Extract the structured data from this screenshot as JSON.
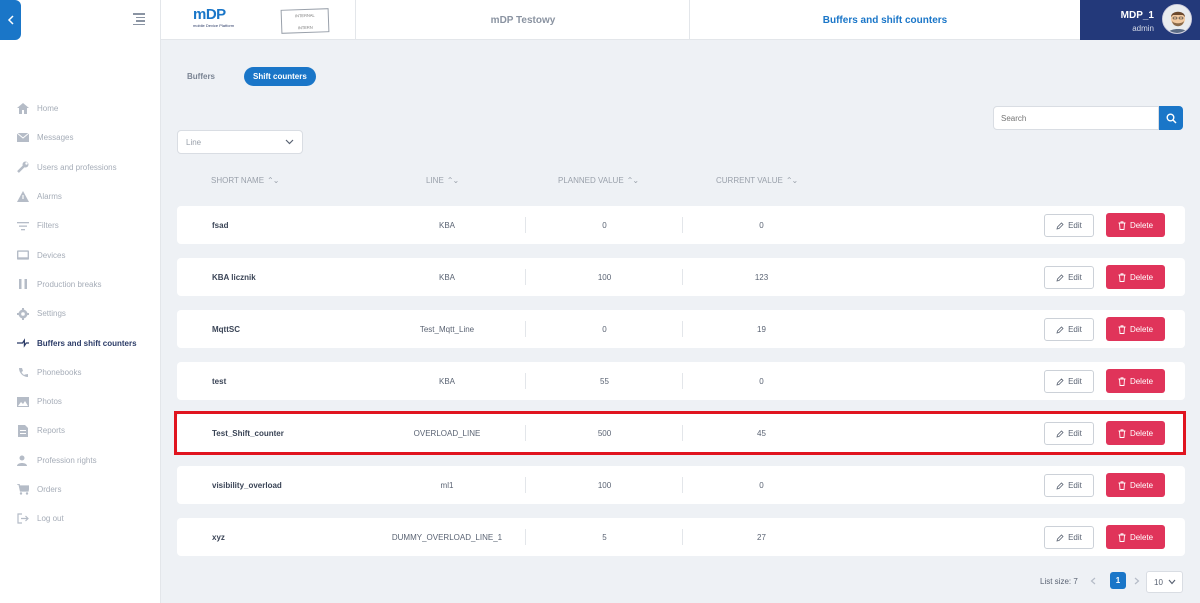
{
  "header": {
    "logo_main": "mDP",
    "logo_sub": "mobile Device Platform",
    "stamp_line1": "INTERNAL",
    "stamp_line2": "INTERN",
    "app_title": "mDP Testowy",
    "page_title": "Buffers and shift counters",
    "user_name": "MDP_1",
    "user_role": "admin"
  },
  "sidebar": {
    "items": [
      {
        "label": "Home",
        "icon": "home-icon"
      },
      {
        "label": "Messages",
        "icon": "mail-icon"
      },
      {
        "label": "Users and professions",
        "icon": "wrench-icon"
      },
      {
        "label": "Alarms",
        "icon": "warning-icon"
      },
      {
        "label": "Filters",
        "icon": "filter-icon"
      },
      {
        "label": "Devices",
        "icon": "devices-icon"
      },
      {
        "label": "Production breaks",
        "icon": "pause-icon"
      },
      {
        "label": "Settings",
        "icon": "gear-icon"
      },
      {
        "label": "Buffers and shift counters",
        "icon": "buffers-icon",
        "active": true
      },
      {
        "label": "Phonebooks",
        "icon": "phone-icon"
      },
      {
        "label": "Photos",
        "icon": "photo-icon"
      },
      {
        "label": "Reports",
        "icon": "report-icon"
      },
      {
        "label": "Profession rights",
        "icon": "user-key-icon"
      },
      {
        "label": "Orders",
        "icon": "cart-icon"
      },
      {
        "label": "Log out",
        "icon": "logout-icon"
      }
    ]
  },
  "tabs": [
    {
      "label": "Buffers",
      "active": false
    },
    {
      "label": "Shift counters",
      "active": true
    }
  ],
  "filter": {
    "placeholder": "Line"
  },
  "search": {
    "placeholder": "Search"
  },
  "columns": {
    "short_name": "SHORT NAME",
    "line": "LINE",
    "planned": "PLANNED VALUE",
    "current": "CURRENT VALUE"
  },
  "rows": [
    {
      "name": "fsad",
      "line": "KBA",
      "planned": "0",
      "current": "0"
    },
    {
      "name": "KBA licznik",
      "line": "KBA",
      "planned": "100",
      "current": "123"
    },
    {
      "name": "MqttSC",
      "line": "Test_Mqtt_Line",
      "planned": "0",
      "current": "19"
    },
    {
      "name": "test",
      "line": "KBA",
      "planned": "55",
      "current": "0"
    },
    {
      "name": "Test_Shift_counter",
      "line": "OVERLOAD_LINE",
      "planned": "500",
      "current": "45"
    },
    {
      "name": "visibility_overload",
      "line": "ml1",
      "planned": "100",
      "current": "0"
    },
    {
      "name": "xyz",
      "line": "DUMMY_OVERLOAD_LINE_1",
      "planned": "5",
      "current": "27"
    }
  ],
  "actions": {
    "edit": "Edit",
    "delete": "Delete"
  },
  "pagination": {
    "list_size": "List size: 7",
    "current_page": "1",
    "page_size": "10"
  },
  "colors": {
    "primary": "#1a76c8",
    "header_user_bg": "#23397a",
    "delete": "#e0345a",
    "highlight": "#e0141f"
  }
}
